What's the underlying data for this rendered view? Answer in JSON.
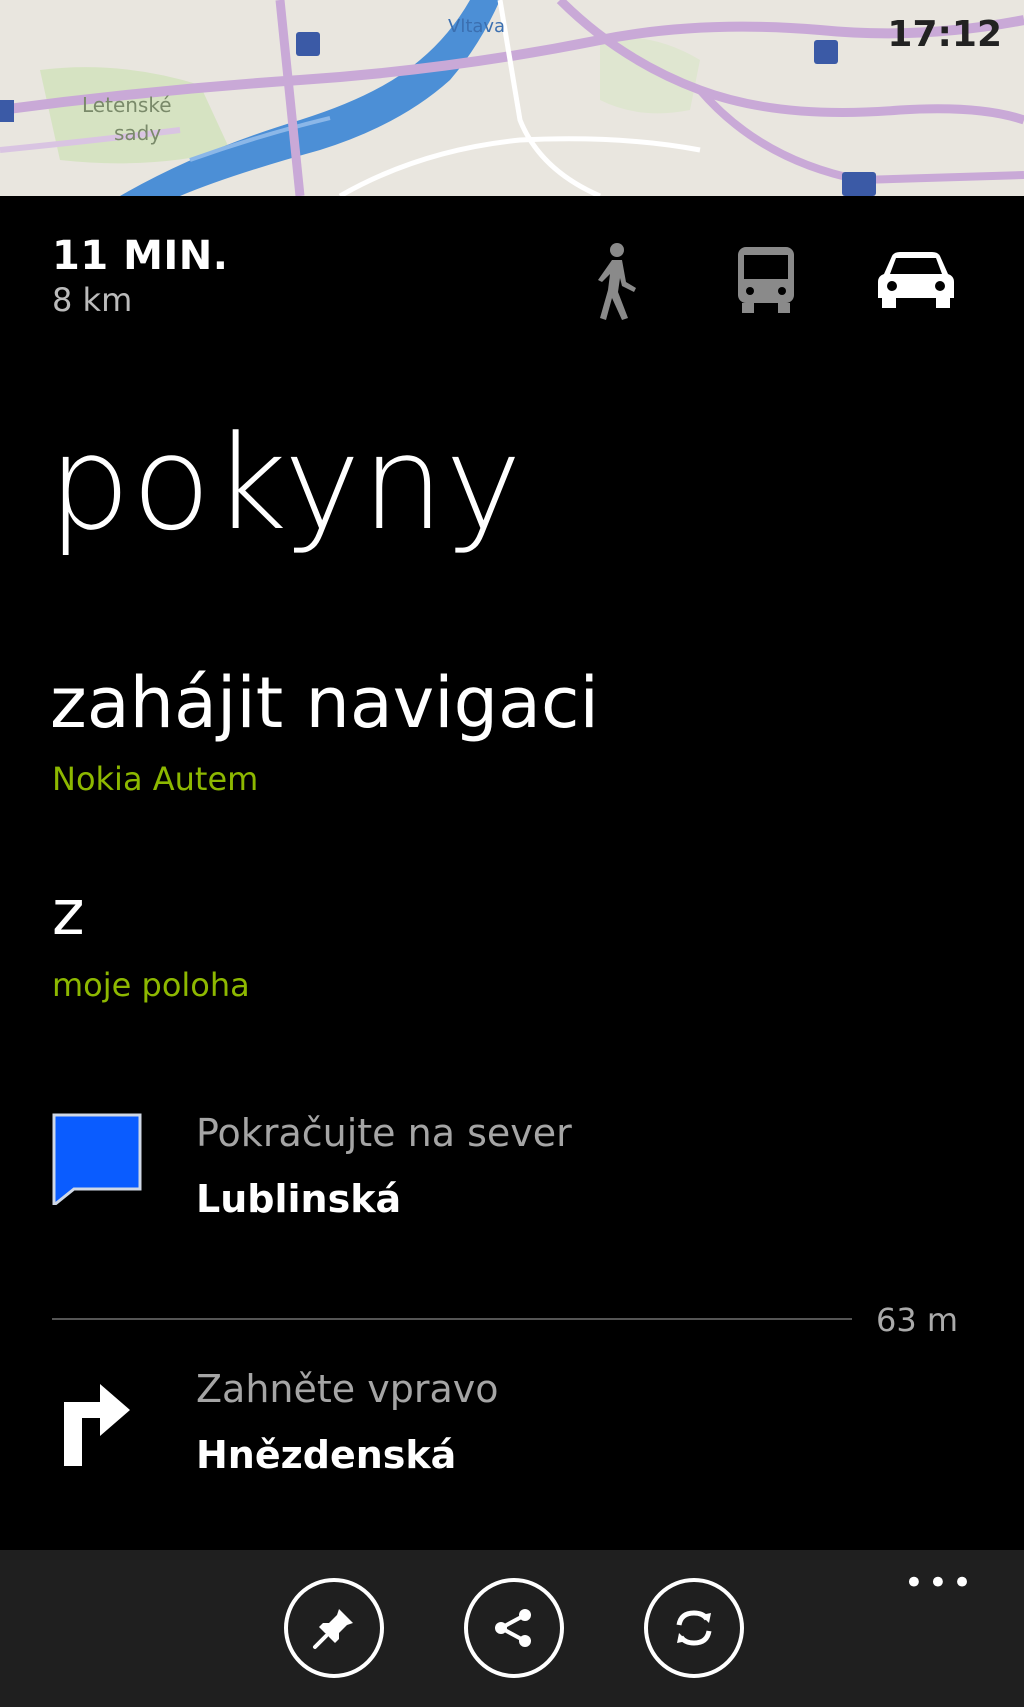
{
  "status_bar": {
    "time": "17:12"
  },
  "map": {
    "labels": {
      "park": "Letenské\nsady",
      "river": "Vltava"
    },
    "colors": {
      "water": "#4c8fd6",
      "road": "#c9a9d7",
      "land": "#e9e6df",
      "park": "#cfe0b4"
    },
    "icons": [
      "metro-icon",
      "metro-icon",
      "metro-icon",
      "highway-shield-icon"
    ]
  },
  "route": {
    "duration": "11 MIN.",
    "distance": "8 km"
  },
  "modes": [
    {
      "name": "walk",
      "icon": "walking-person-icon",
      "active": false
    },
    {
      "name": "transit",
      "icon": "bus-icon",
      "active": false
    },
    {
      "name": "car",
      "icon": "car-icon",
      "active": true
    }
  ],
  "page": {
    "title": "pokyny",
    "start_navigation": "zahájit navigaci",
    "start_navigation_app": "Nokia Autem",
    "from_label": "z",
    "from_value": "moje poloha"
  },
  "steps": [
    {
      "instruction": "Pokračujte na sever",
      "street": "Lublinská",
      "icon": "start-flag-icon",
      "distance_after": "63 m"
    },
    {
      "instruction": "Zahněte vpravo",
      "street": "Hnězdenská",
      "icon": "turn-right-icon"
    }
  ],
  "appbar": {
    "buttons": [
      {
        "name": "pin",
        "icon": "pin-icon"
      },
      {
        "name": "share",
        "icon": "share-icon"
      },
      {
        "name": "refresh",
        "icon": "refresh-icon"
      }
    ],
    "more": "•••"
  },
  "colors": {
    "accent": "#8db800",
    "background": "#000000",
    "appbar": "#1f1f1f",
    "flag": "#0a5cff"
  }
}
